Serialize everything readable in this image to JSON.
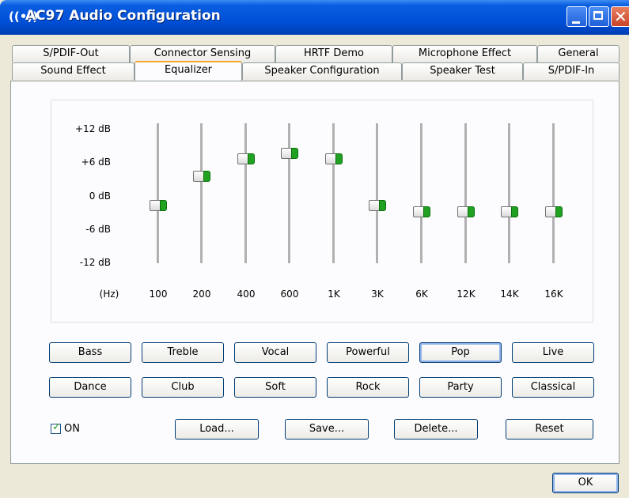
{
  "window": {
    "title": "AC97 Audio Configuration",
    "icon": "speaker-wave-icon"
  },
  "tabs_row1": [
    "S/PDIF-Out",
    "Connector Sensing",
    "HRTF Demo",
    "Microphone Effect",
    "General"
  ],
  "tabs_row2": [
    "Sound Effect",
    "Equalizer",
    "Speaker Configuration",
    "Speaker Test",
    "S/PDIF-In"
  ],
  "active_tab": "Equalizer",
  "equalizer": {
    "db_labels": [
      "+12 dB",
      "+6 dB",
      "0 dB",
      "-6 dB",
      "-12 dB"
    ],
    "hz_label": "(Hz)",
    "bands": [
      "100",
      "200",
      "400",
      "600",
      "1K",
      "3K",
      "6K",
      "12K",
      "14K",
      "16K"
    ],
    "levels_db": [
      -2,
      3,
      6,
      7,
      6,
      -2,
      -3,
      -3,
      -3,
      -3
    ]
  },
  "presets_row1": [
    "Bass",
    "Treble",
    "Vocal",
    "Powerful",
    "Pop",
    "Live"
  ],
  "presets_row2": [
    "Dance",
    "Club",
    "Soft",
    "Rock",
    "Party",
    "Classical"
  ],
  "selected_preset": "Pop",
  "on_checkbox": {
    "label": "ON",
    "checked": true
  },
  "actions": [
    "Load...",
    "Save...",
    "Delete...",
    "Reset"
  ],
  "ok_label": "OK",
  "colors": {
    "titlebar": "#0050d8",
    "slider_tip": "#21a121",
    "tab_highlight": "#f9a72b"
  }
}
